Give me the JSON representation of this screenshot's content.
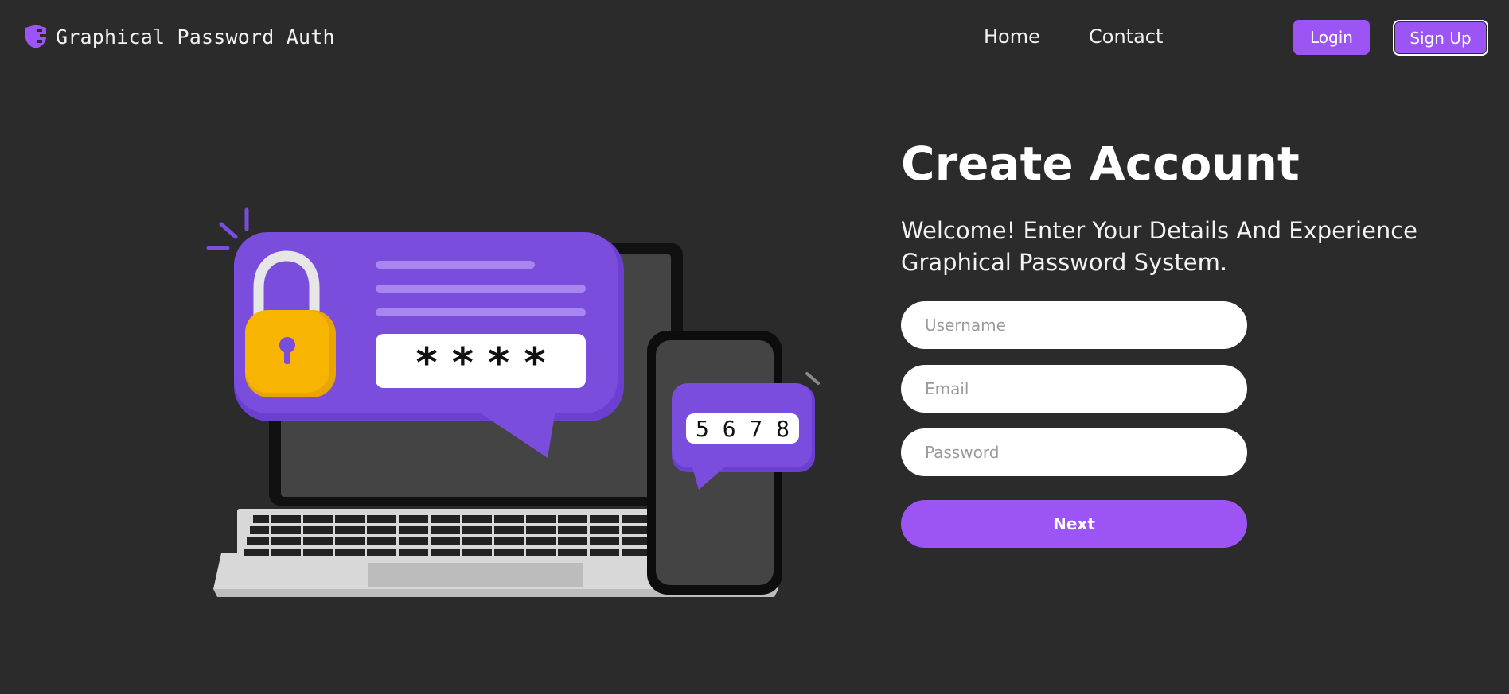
{
  "nav": {
    "brand": "Graphical Password Auth",
    "links": [
      "Home",
      "Contact"
    ],
    "login_label": "Login",
    "signup_label": "Sign Up"
  },
  "illustration": {
    "password_mask": "* * * *",
    "otp_code": "5 6 7 8",
    "colors": {
      "purple": "#7a4ddc",
      "lock": "#f7b400"
    }
  },
  "form": {
    "title": "Create Account",
    "subtitle": "Welcome! Enter Your Details And Experience Graphical Password System.",
    "username_placeholder": "Username",
    "email_placeholder": "Email",
    "password_placeholder": "Password",
    "next_label": "Next"
  },
  "colors": {
    "background": "#2b2b2b",
    "accent": "#9d54f5"
  }
}
